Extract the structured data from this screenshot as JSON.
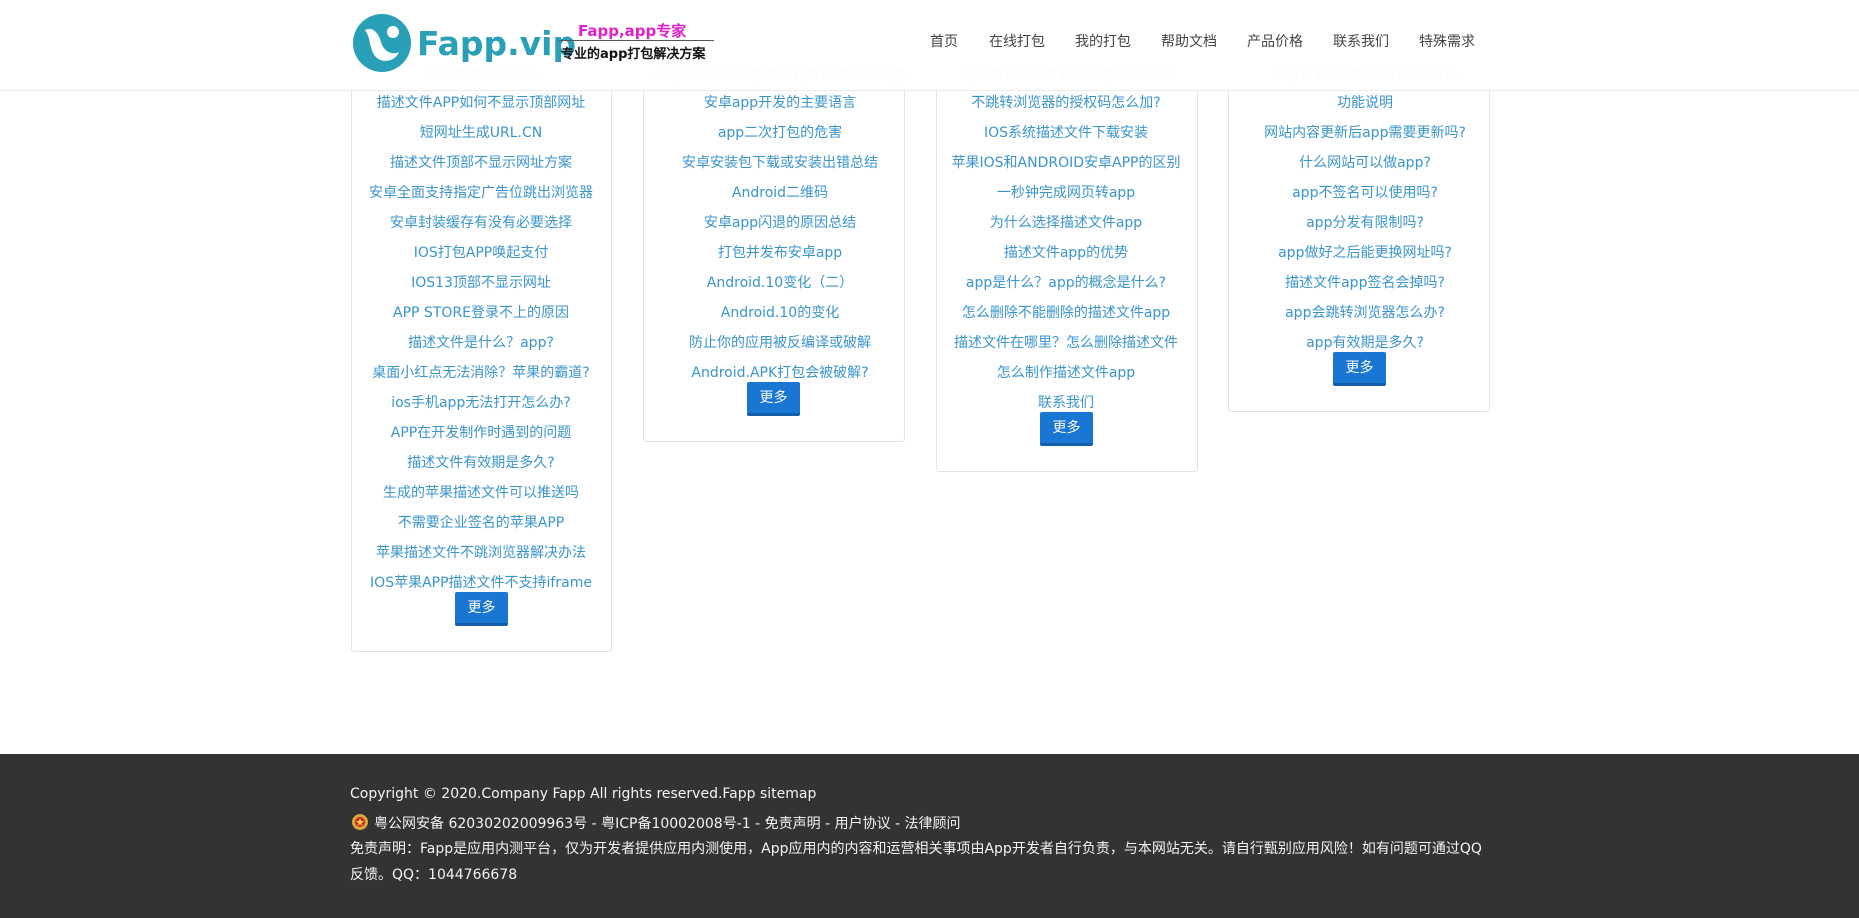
{
  "header": {
    "logo_text": "Fapp.vip",
    "slogan_top": "Fapp,app专家",
    "slogan_bottom": "专业的app打包解决方案",
    "nav": [
      "首页",
      "在线打包",
      "我的打包",
      "帮助文档",
      "产品价格",
      "联系我们",
      "特殊需求"
    ]
  },
  "columns": [
    {
      "hidden_top": "描述文件显示网址",
      "links": [
        "描述文件APP如何不显示顶部网址",
        "短网址生成URL.CN",
        "描述文件顶部不显示网址方案",
        "安卓全面支持指定广告位跳出浏览器",
        "安卓封装缓存有没有必要选择",
        "IOS打包APP唤起支付",
        "IOS13顶部不显示网址",
        "APP STORE登录不上的原因",
        "描述文件是什么？app?",
        "桌面小红点无法消除？苹果的霸道?",
        "ios手机app无法打开怎么办?",
        "APP在开发制作时遇到的问题",
        "描述文件有效期是多久?",
        "生成的苹果描述文件可以推送吗",
        "不需要企业签名的苹果APP",
        "苹果描述文件不跳浏览器解决办法",
        "IOS苹果APP描述文件不支持iframe"
      ],
      "more": "更多"
    },
    {
      "hidden_top": "安卓封装APP之后怎么样才能跳转浏览器",
      "links": [
        "安卓app开发的主要语言",
        "app二次打包的危害",
        "安卓安装包下载或安装出错总结",
        "Android二维码",
        "安卓app闪退的原因总结",
        "打包并发布安卓app",
        "Android.10变化（二）",
        "Android.10的变化",
        "防止你的应用被反编译或破解",
        "Android.APK打包会被破解?"
      ],
      "more": "更多"
    },
    {
      "hidden_top": "苹果跳转APP需要安装苹果的证书",
      "links": [
        "不跳转浏览器的授权码怎么加?",
        "IOS系统描述文件下载安装",
        "苹果IOS和ANDROID安卓APP的区别",
        "一秒钟完成网页转app",
        "为什么选择描述文件app",
        "描述文件app的优势",
        "app是什么？app的概念是什么?",
        "怎么删除不能删除的描述文件app",
        "描述文件在哪里？怎么删除描述文件",
        "怎么制作描述文件app",
        "联系我们"
      ],
      "more": "更多"
    },
    {
      "hidden_top": "安卓打包APP如何支持嵌入H5",
      "links": [
        "功能说明",
        "网站内容更新后app需要更新吗?",
        "什么网站可以做app?",
        "app不签名可以使用吗?",
        "app分发有限制吗?",
        "app做好之后能更换网址吗?",
        "描述文件app签名会掉吗?",
        "app会跳转浏览器怎么办?",
        "app有效期是多久?"
      ],
      "more": "更多"
    }
  ],
  "footer": {
    "copyright": "Copyright © 2020.Company Fapp All rights reserved.Fapp sitemap",
    "beian_gongan": "粤公网安备 62030202009963号",
    "sep": " - ",
    "beian_icp": "粤ICP备10002008号-1",
    "disclaimer_link": "免责声明",
    "user_agreement": "用户协议",
    "legal": "法律顾问",
    "disclaimer_line1": "免责声明：Fapp是应用内测平台，仅为开发者提供应用内测使用，App应用内的内容和运营相关事项由App开发者自行负责，与本网站无关。请自行甄别应用风险！如有问题可通过QQ",
    "disclaimer_line2": "反馈。QQ：1044766678"
  },
  "colors": {
    "link": "#3a95cc",
    "button": "#1976d2",
    "footer_bg": "#333333",
    "logo": "#2aa0b8",
    "slogan": "#e020c8"
  }
}
